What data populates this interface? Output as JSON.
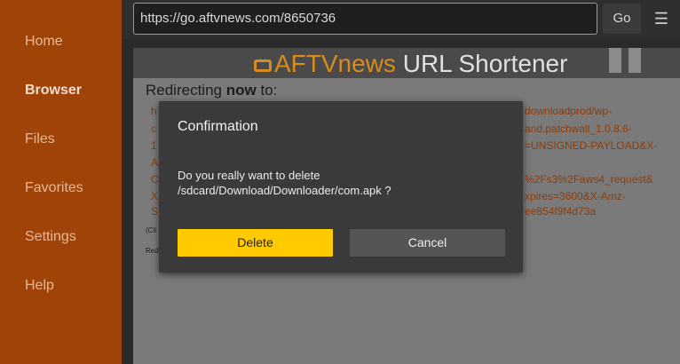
{
  "sidebar": {
    "items": [
      {
        "label": "Home"
      },
      {
        "label": "Browser"
      },
      {
        "label": "Files"
      },
      {
        "label": "Favorites"
      },
      {
        "label": "Settings"
      },
      {
        "label": "Help"
      }
    ],
    "active_item": "Browser"
  },
  "toolbar": {
    "url": "https://go.aftvnews.com/8650736",
    "go_label": "Go",
    "menu_icon": "hamburger-icon",
    "menu_glyph": "☰"
  },
  "webpage": {
    "logo_brand": "AFTVnews",
    "logo_suffix": " URL Shortener",
    "redirect_prefix": "Redirecting ",
    "redirect_emphasis": "now",
    "redirect_suffix": " to:",
    "url_fragments_left": [
      "h",
      "c",
      "1",
      "A",
      "C",
      "X",
      "S"
    ],
    "url_fragments_right": [
      "downloadprod/wp-",
      "and.patchwall_1.0.8.6-",
      "=UNSIGNED-PAYLOAD&X-",
      "%2Fs3%2Faws4_request&",
      "xpires=3600&X-Amz-",
      "ee854f9f4d73a"
    ],
    "small_fragments": [
      "(Cli",
      "Red"
    ]
  },
  "dialog": {
    "title": "Confirmation",
    "message": "Do you really want to delete /sdcard/Download/Downloader/com.apk ?",
    "delete_label": "Delete",
    "cancel_label": "Cancel"
  },
  "colors": {
    "sidebar": "#a04309",
    "accent_button": "#ffcb00",
    "brand": "#d98b1b"
  }
}
